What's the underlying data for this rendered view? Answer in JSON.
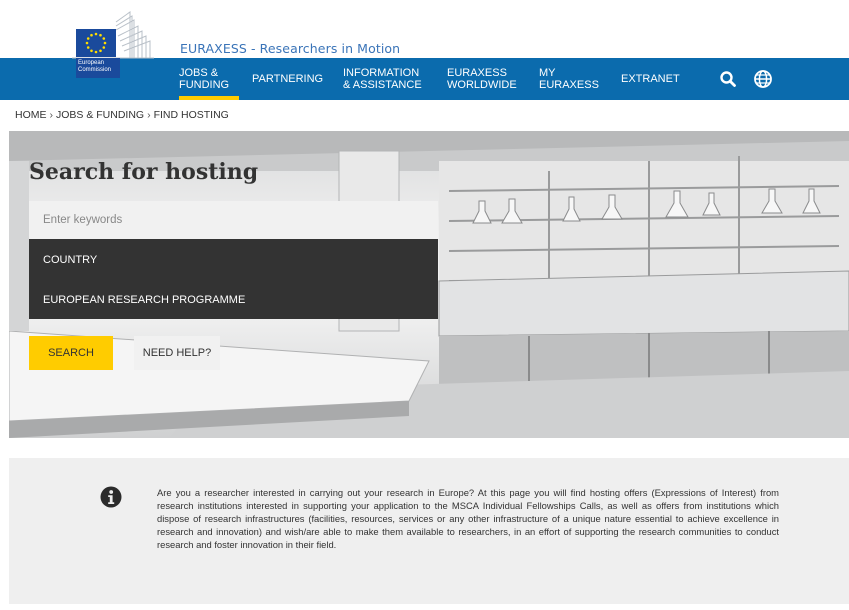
{
  "header": {
    "logo_label": "European Commission",
    "site_title": "EURAXESS - Researchers in Motion"
  },
  "nav": {
    "items": [
      {
        "label": "JOBS &\nFUNDING",
        "active": true
      },
      {
        "label": "PARTNERING",
        "active": false
      },
      {
        "label": "INFORMATION\n& ASSISTANCE",
        "active": false
      },
      {
        "label": "EURAXESS\nWORLDWIDE",
        "active": false
      },
      {
        "label": "MY\nEURAXESS",
        "active": false
      },
      {
        "label": "EXTRANET",
        "active": false
      }
    ],
    "search_icon": "search-icon",
    "language_icon": "globe-icon"
  },
  "breadcrumb": [
    "HOME",
    "JOBS & FUNDING",
    "FIND HOSTING"
  ],
  "breadcrumb_separator": "›",
  "hero": {
    "title": "Search for hosting",
    "keywords_placeholder": "Enter keywords",
    "filters": [
      "COUNTRY",
      "EUROPEAN RESEARCH PROGRAMME"
    ],
    "search_button": "SEARCH",
    "help_button": "NEED HELP?"
  },
  "info": {
    "icon": "info-icon",
    "text": "Are you a researcher interested in carrying out your research in Europe? At this page you will find hosting offers (Expressions of Interest) from research institutions interested in supporting your application to the MSCA Individual Fellowships Calls, as well as offers from institutions which dispose of research infrastructures (facilities, resources, services or any other infrastructure of a unique nature essential to achieve excellence in research and innovation) and wish/are able to make them available to researchers, in an effort of supporting the research communities to conduct research and foster innovation in their field."
  },
  "colors": {
    "nav_bg": "#0b6bad",
    "accent": "#ffcc00",
    "dropdown_bg": "#333333",
    "title_blue": "#3a74b8"
  }
}
